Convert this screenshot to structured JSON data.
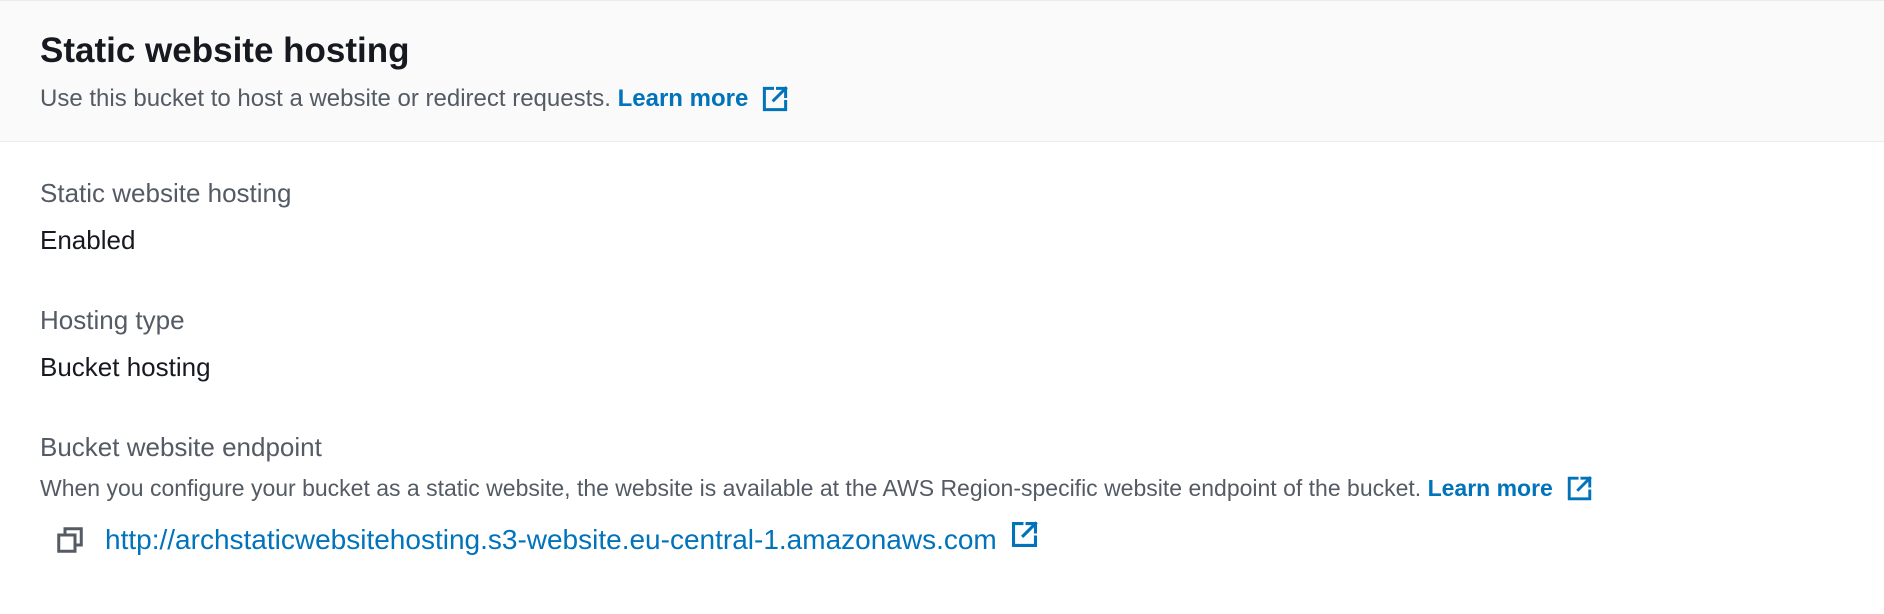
{
  "header": {
    "title": "Static website hosting",
    "description": "Use this bucket to host a website or redirect requests.",
    "learn_more": "Learn more",
    "external_icon": "external-link-icon"
  },
  "fields": {
    "hosting": {
      "label": "Static website hosting",
      "value": "Enabled"
    },
    "hosting_type": {
      "label": "Hosting type",
      "value": "Bucket hosting"
    },
    "endpoint": {
      "label": "Bucket website endpoint",
      "description": "When you configure your bucket as a static website, the website is available at the AWS Region-specific website endpoint of the bucket.",
      "learn_more": "Learn more",
      "url": "http://archstaticwebsitehosting.s3-website.eu-central-1.amazonaws.com",
      "copy_icon": "copy-icon",
      "external_icon": "external-link-icon"
    }
  },
  "colors": {
    "link": "#0073bb",
    "header_bg": "#fafafa",
    "label": "#545b64",
    "text": "#16191f"
  }
}
